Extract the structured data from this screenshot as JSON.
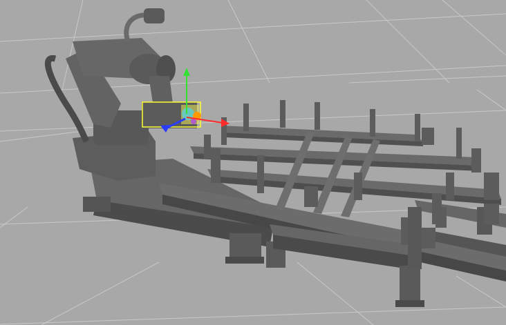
{
  "viewport": {
    "background": "#a8a8a8",
    "grid_color": "#c9c9c9"
  },
  "model": {
    "body_color": "#5f5f5f",
    "shadow_color": "#474747",
    "highlight_color": "#7a7a7a"
  },
  "gizmo": {
    "x_axis_color": "#ff2a2a",
    "y_axis_color": "#33e033",
    "z_axis_color": "#2a3cff",
    "selection_box_color": "#ffff33",
    "center_color": "#ff9900"
  }
}
